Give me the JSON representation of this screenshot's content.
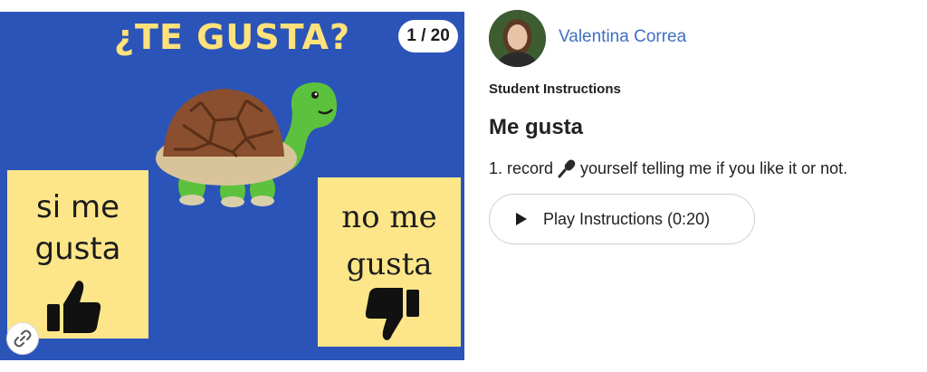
{
  "slide": {
    "title": "¿TE GUSTA?",
    "page_counter": "1 / 20",
    "card_like_text": "si me gusta",
    "card_dislike_text": "no me gusta",
    "background_color": "#2b54b8",
    "card_color": "#fde68a",
    "title_color": "#ffe27a",
    "icons": [
      "turtle-illustration",
      "thumbs-up-icon",
      "thumbs-down-icon",
      "link-icon"
    ]
  },
  "teacher": {
    "name": "Valentina Correa"
  },
  "instructions": {
    "label": "Student Instructions",
    "title": "Me gusta",
    "line_prefix": "1. record",
    "line_suffix": "yourself telling me if you like it or not.",
    "play_button_label": "Play Instructions (0:20)"
  },
  "colors": {
    "link_blue": "#3f6fc3",
    "text_dark": "#222222"
  }
}
